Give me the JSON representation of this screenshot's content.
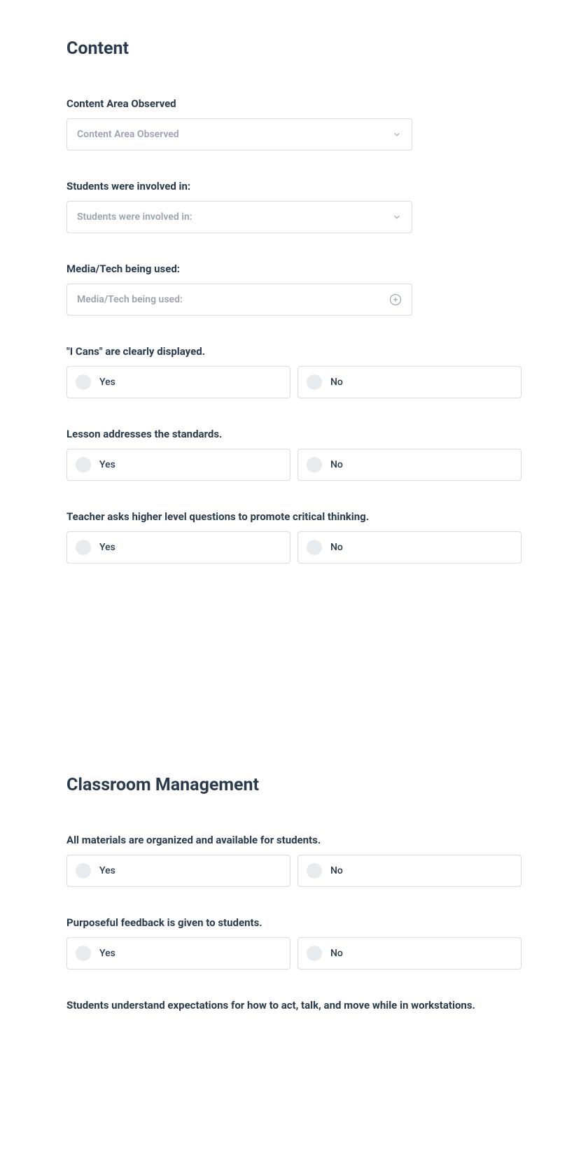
{
  "sections": {
    "content": {
      "title": "Content",
      "fields": {
        "content_area": {
          "label": "Content Area Observed",
          "placeholder": "Content Area Observed"
        },
        "students_involved": {
          "label": "Students were involved in:",
          "placeholder": "Students were involved in:"
        },
        "media_tech": {
          "label": "Media/Tech being used:",
          "placeholder": "Media/Tech being used:"
        },
        "i_cans": {
          "label": "\"I Cans\" are clearly displayed.",
          "yes": "Yes",
          "no": "No"
        },
        "lesson_standards": {
          "label": "Lesson addresses the standards.",
          "yes": "Yes",
          "no": "No"
        },
        "higher_questions": {
          "label": "Teacher asks higher level questions to promote critical thinking.",
          "yes": "Yes",
          "no": "No"
        }
      }
    },
    "classroom": {
      "title": "Classroom Management",
      "fields": {
        "materials_organized": {
          "label": "All materials are organized and available for students.",
          "yes": "Yes",
          "no": "No"
        },
        "purposeful_feedback": {
          "label": "Purposeful feedback is given to students.",
          "yes": "Yes",
          "no": "No"
        },
        "expectations": {
          "label": "Students understand expectations for how to act, talk, and move while in workstations."
        }
      }
    }
  }
}
